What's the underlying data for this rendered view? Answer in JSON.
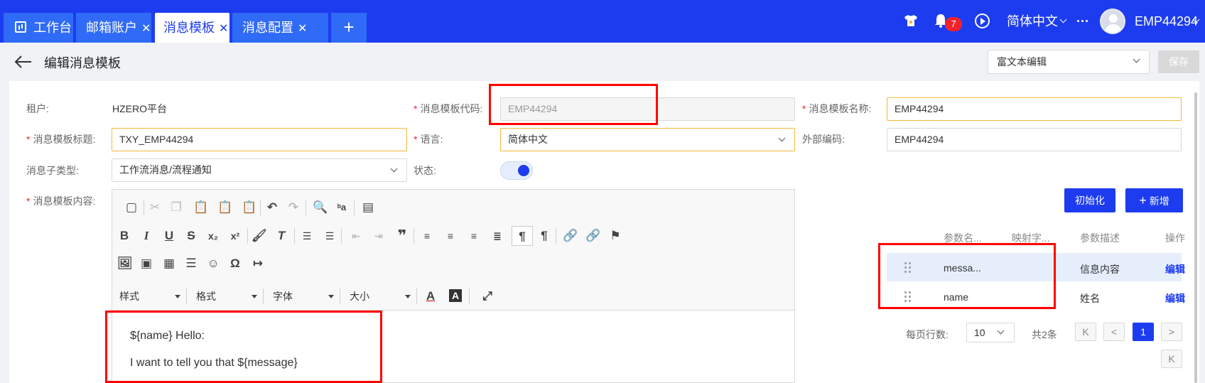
{
  "tabs": [
    {
      "label": "工作台",
      "closable": false
    },
    {
      "label": "邮箱账户",
      "closable": true
    },
    {
      "label": "消息模板",
      "closable": true,
      "active": true
    },
    {
      "label": "消息配置",
      "closable": true
    }
  ],
  "tab_close_glyph": "✕",
  "tab_add_glyph": "+",
  "header": {
    "notification_count": "7",
    "language": "简体中文",
    "more": "···",
    "username": "EMP44294"
  },
  "page": {
    "title": "编辑消息模板",
    "mode_select": "富文本编辑",
    "save_label": "保存"
  },
  "form": {
    "tenant_label": "租户:",
    "tenant_value": "HZERO平台",
    "code_label": "消息模板代码:",
    "code_value": "EMP44294",
    "name_label": "消息模板名称:",
    "name_value": "EMP44294",
    "title_label": "消息模板标题:",
    "title_value": "TXY_EMP44294",
    "lang_label": "语言:",
    "lang_value": "简体中文",
    "extcode_label": "外部编码:",
    "extcode_value": "EMP44294",
    "subtype_label": "消息子类型:",
    "subtype_value": "工作流消息/流程通知",
    "status_label": "状态:",
    "status_on": true,
    "content_label": "消息模板内容:"
  },
  "editor": {
    "combos": [
      "样式",
      "格式",
      "字体",
      "大小"
    ],
    "lines": [
      "${name} Hello:",
      "I want to tell you that ${message}"
    ]
  },
  "params": {
    "init_label": "初始化",
    "add_label": "新增",
    "add_icon": "+",
    "columns": [
      "参数名...",
      "映射字...",
      "参数描述",
      "操作"
    ],
    "rows": [
      {
        "name": "messa...",
        "mapping": "",
        "desc": "信息内容",
        "action": "编辑"
      },
      {
        "name": "name",
        "mapping": "",
        "desc": "姓名",
        "action": "编辑"
      }
    ]
  },
  "pagination": {
    "page_size_label": "每页行数:",
    "page_size": "10",
    "total": "共2条",
    "current_page": "1",
    "first_glyph": "K",
    "prev_glyph": "<",
    "next_glyph": ">",
    "last_glyph": "K"
  },
  "colors": {
    "topbar": "#1d3cf0",
    "tab": "#2f6bf7",
    "primary": "#1d3cf0",
    "badge": "#f5222d",
    "highlight": "#ff0000"
  }
}
